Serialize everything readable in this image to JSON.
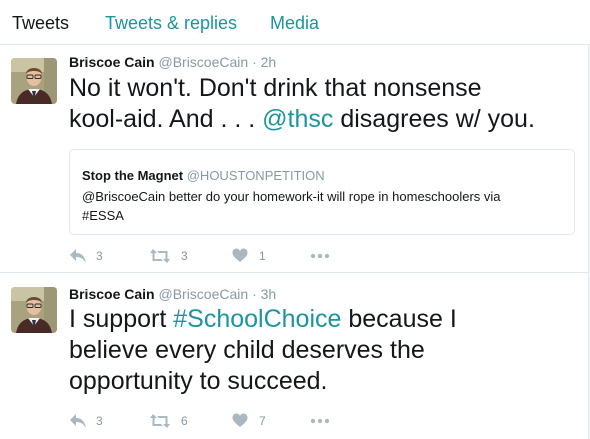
{
  "tabs": [
    {
      "label": "Tweets"
    },
    {
      "label": "Tweets & replies"
    },
    {
      "label": "Media"
    }
  ],
  "colors": {
    "accent": "#1b95a0",
    "muted": "#8899a6",
    "text": "#14171a",
    "border": "#e1e8ed",
    "background": "#f5f8fa"
  },
  "tweets": [
    {
      "name": "Briscoe Cain",
      "handle": "@BriscoeCain",
      "separator": "·",
      "time": "2h",
      "text_line1": "No it won't. Don't drink that nonsense",
      "text_line2_prefix": "kool-aid. And . . . ",
      "mention": "@thsc",
      "text_line2_suffix": " disagrees w/ you.",
      "quote": {
        "name": "Stop the Magnet",
        "handle": "@HOUSTONPETITION",
        "text_line1": "@BriscoeCain better do your homework-it will rope in homeschoolers via",
        "text_line2": "#ESSA"
      },
      "actions": {
        "reply_count": "3",
        "retweet_count": "3",
        "like_count": "1"
      },
      "icons": [
        "reply-icon",
        "retweet-icon",
        "heart-icon",
        "more-icon"
      ]
    },
    {
      "name": "Briscoe Cain",
      "handle": "@BriscoeCain",
      "separator": "·",
      "time": "3h",
      "text_line1_prefix": "I support ",
      "hashtag": "#SchoolChoice",
      "text_line1_suffix": " because I",
      "text_line2": "believe every child deserves the",
      "text_line3": "opportunity to succeed.",
      "actions": {
        "reply_count": "3",
        "retweet_count": "6",
        "like_count": "7"
      },
      "icons": [
        "reply-icon",
        "retweet-icon",
        "heart-icon",
        "more-icon"
      ]
    }
  ]
}
